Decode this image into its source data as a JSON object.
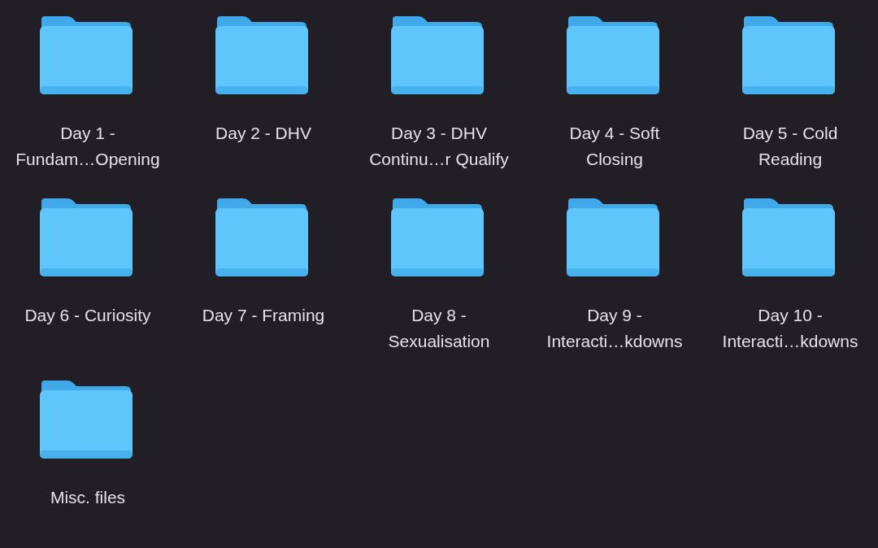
{
  "items": [
    {
      "kind": "folder",
      "label_lines": [
        "Day 1 -",
        "Fundam…Opening"
      ]
    },
    {
      "kind": "folder",
      "label_lines": [
        "Day 2 - DHV"
      ]
    },
    {
      "kind": "folder",
      "label_lines": [
        "Day 3 - DHV",
        "Continu…r Qualify"
      ]
    },
    {
      "kind": "folder",
      "label_lines": [
        "Day 4 - Soft",
        "Closing"
      ]
    },
    {
      "kind": "folder",
      "label_lines": [
        "Day 5 - Cold",
        "Reading"
      ]
    },
    {
      "kind": "folder",
      "label_lines": [
        "Day 6 - Curiosity"
      ]
    },
    {
      "kind": "folder",
      "label_lines": [
        "Day 7 - Framing"
      ]
    },
    {
      "kind": "folder",
      "label_lines": [
        "Day 8 -",
        "Sexualisation"
      ]
    },
    {
      "kind": "folder",
      "label_lines": [
        "Day 9 -",
        "Interacti…kdowns"
      ]
    },
    {
      "kind": "folder",
      "label_lines": [
        "Day 10 -",
        "Interacti…kdowns"
      ]
    },
    {
      "kind": "folder",
      "label_lines": [
        "Misc. files"
      ]
    }
  ]
}
